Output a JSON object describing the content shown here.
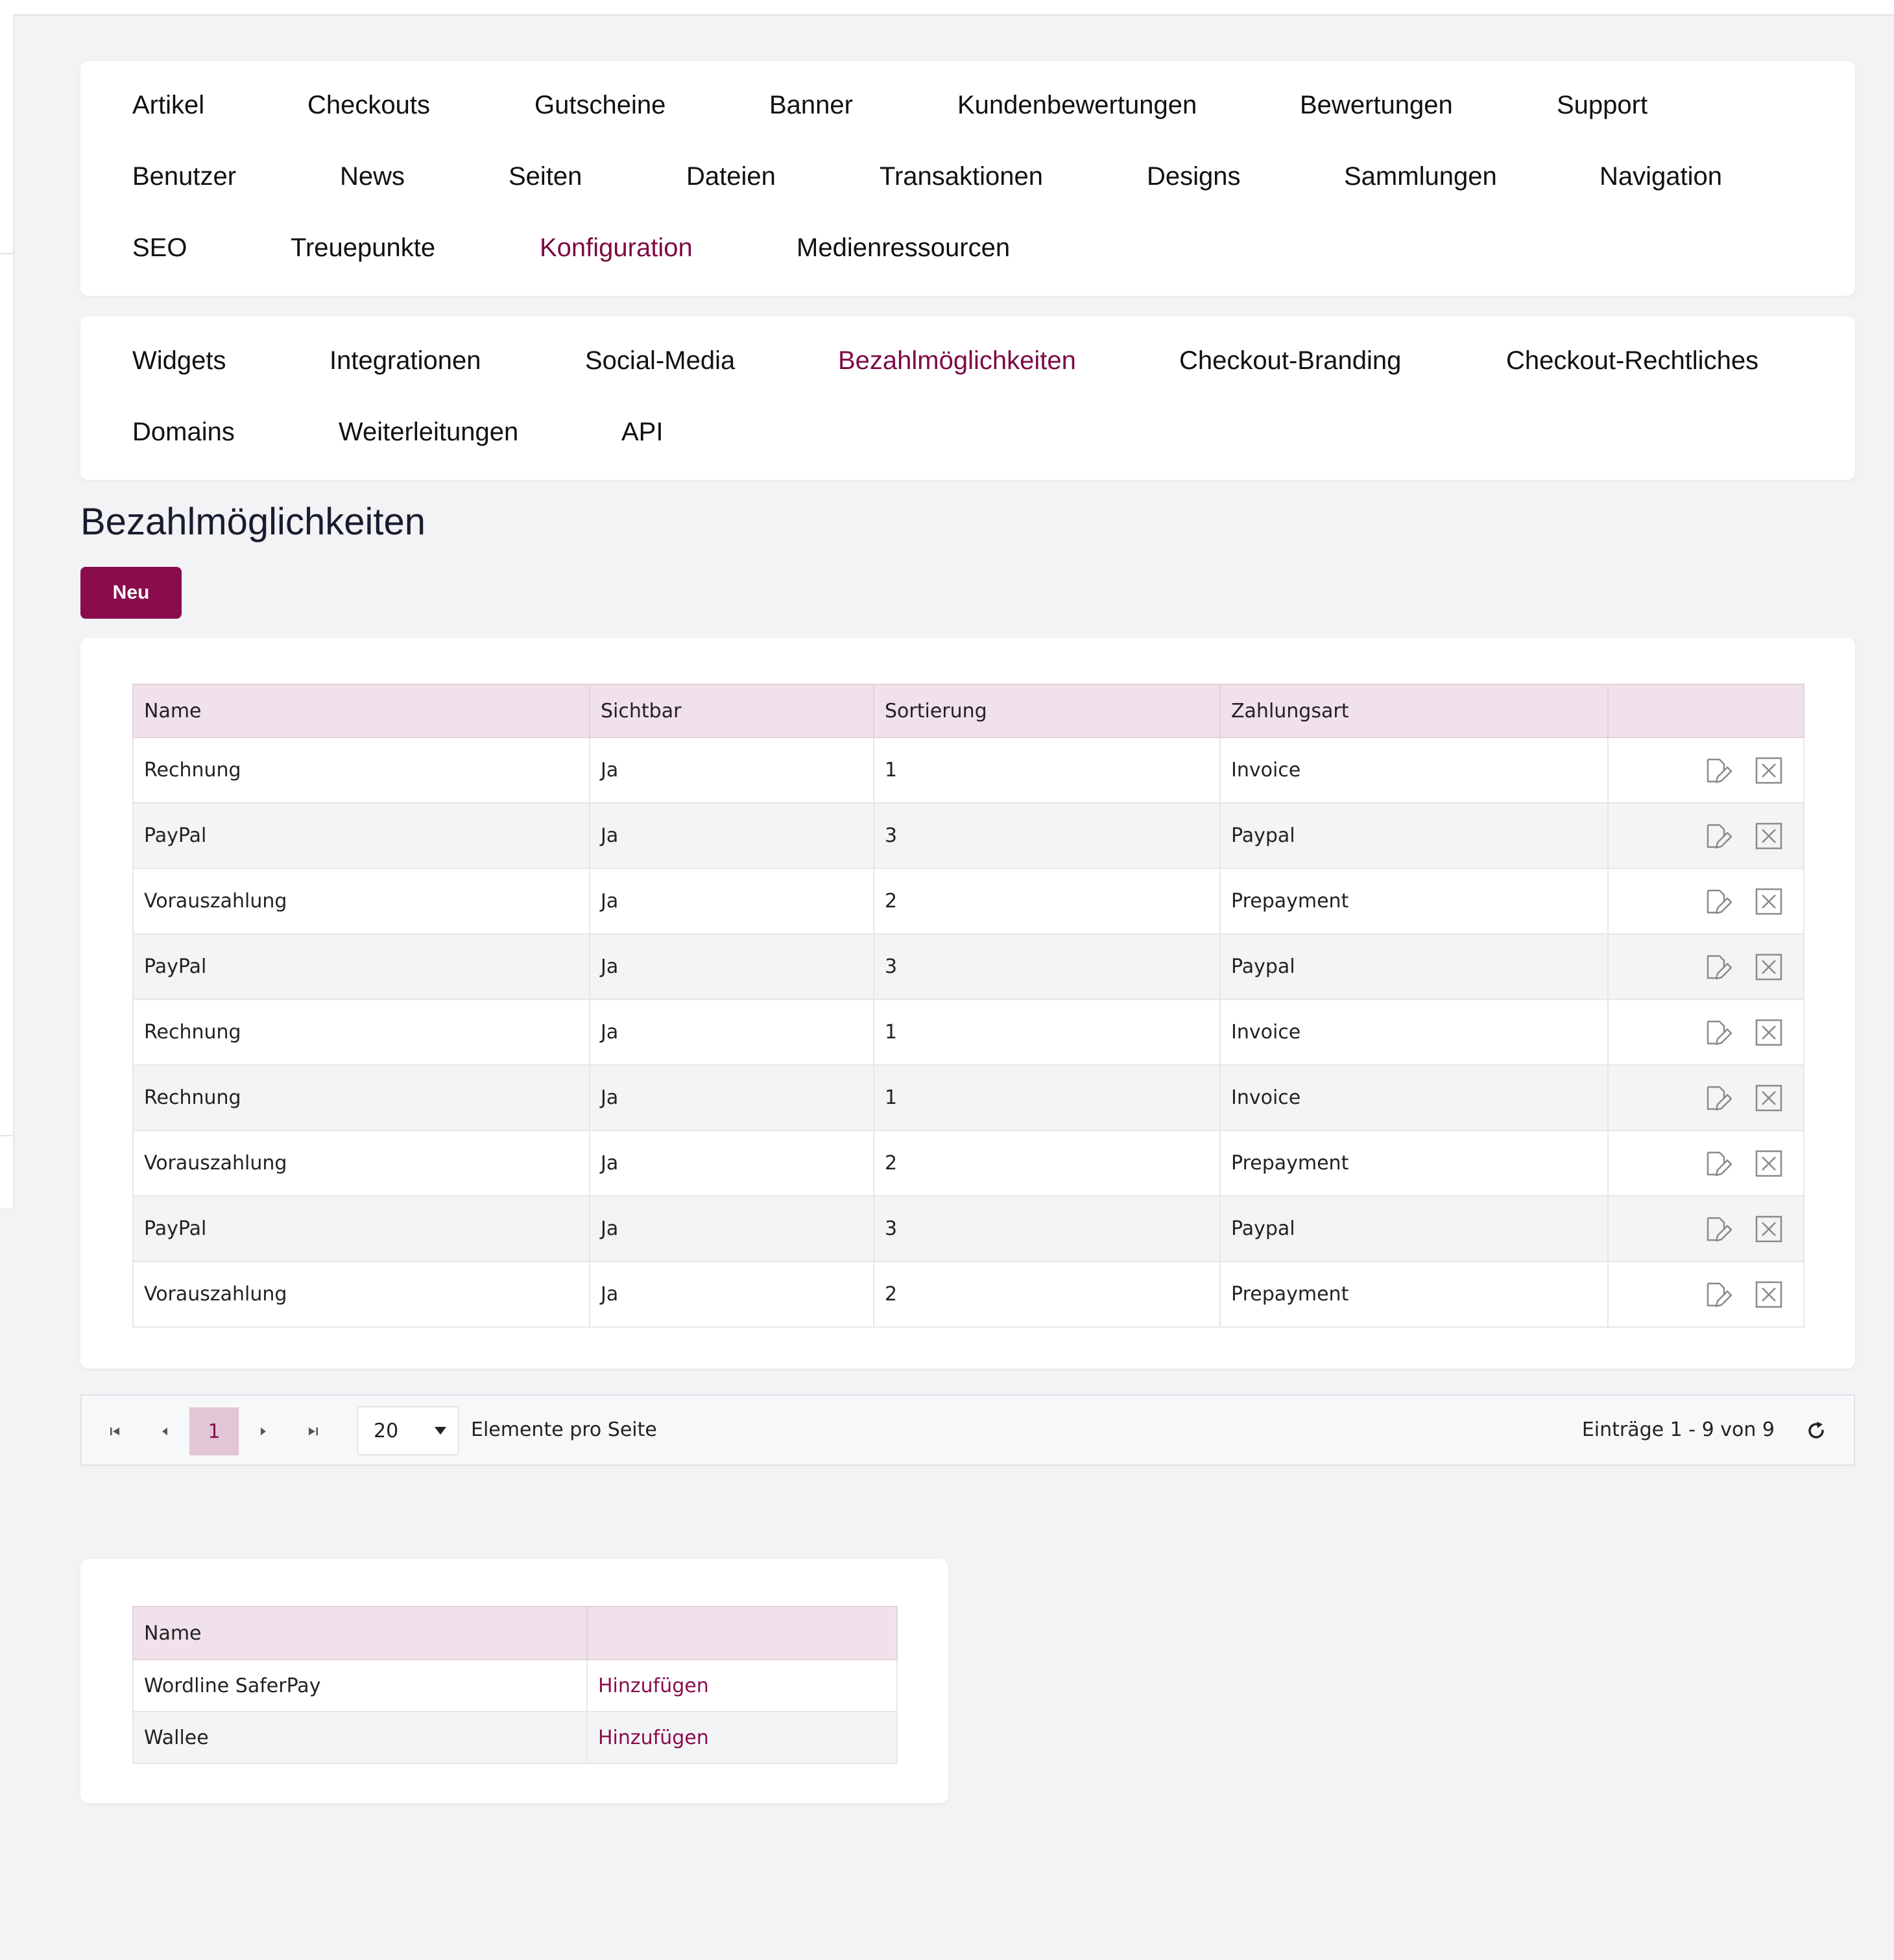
{
  "main_nav": {
    "items": [
      {
        "label": "Artikel",
        "active": false
      },
      {
        "label": "Checkouts",
        "active": false
      },
      {
        "label": "Gutscheine",
        "active": false
      },
      {
        "label": "Banner",
        "active": false
      },
      {
        "label": "Kundenbewertungen",
        "active": false
      },
      {
        "label": "Bewertungen",
        "active": false
      },
      {
        "label": "Support",
        "active": false
      },
      {
        "label": "Benutzer",
        "active": false
      },
      {
        "label": "News",
        "active": false
      },
      {
        "label": "Seiten",
        "active": false
      },
      {
        "label": "Dateien",
        "active": false
      },
      {
        "label": "Transaktionen",
        "active": false
      },
      {
        "label": "Designs",
        "active": false
      },
      {
        "label": "Sammlungen",
        "active": false
      },
      {
        "label": "Navigation",
        "active": false
      },
      {
        "label": "SEO",
        "active": false
      },
      {
        "label": "Treuepunkte",
        "active": false
      },
      {
        "label": "Konfiguration",
        "active": true
      },
      {
        "label": "Medienressourcen",
        "active": false
      }
    ]
  },
  "sub_nav": {
    "items": [
      {
        "label": "Widgets",
        "active": false
      },
      {
        "label": "Integrationen",
        "active": false
      },
      {
        "label": "Social-Media",
        "active": false
      },
      {
        "label": "Bezahlmöglichkeiten",
        "active": true
      },
      {
        "label": "Checkout-Branding",
        "active": false
      },
      {
        "label": "Checkout-Rechtliches",
        "active": false
      },
      {
        "label": "Domains",
        "active": false
      },
      {
        "label": "Weiterleitungen",
        "active": false
      },
      {
        "label": "API",
        "active": false
      }
    ]
  },
  "page": {
    "title": "Bezahlmöglichkeiten",
    "new_button": "Neu"
  },
  "table": {
    "columns": [
      "Name",
      "Sichtbar",
      "Sortierung",
      "Zahlungsart",
      ""
    ],
    "rows": [
      [
        "Rechnung",
        "Ja",
        "1",
        "Invoice"
      ],
      [
        "PayPal",
        "Ja",
        "3",
        "Paypal"
      ],
      [
        "Vorauszahlung",
        "Ja",
        "2",
        "Prepayment"
      ],
      [
        "PayPal",
        "Ja",
        "3",
        "Paypal"
      ],
      [
        "Rechnung",
        "Ja",
        "1",
        "Invoice"
      ],
      [
        "Rechnung",
        "Ja",
        "1",
        "Invoice"
      ],
      [
        "Vorauszahlung",
        "Ja",
        "2",
        "Prepayment"
      ],
      [
        "PayPal",
        "Ja",
        "3",
        "Paypal"
      ],
      [
        "Vorauszahlung",
        "Ja",
        "2",
        "Prepayment"
      ]
    ],
    "row_actions": [
      "edit-icon",
      "delete-icon"
    ]
  },
  "pagination": {
    "current_page": "1",
    "page_size": "20",
    "page_size_label": "Elemente pro Seite",
    "info": "Einträge 1 - 9 von 9",
    "icons": [
      "first-page-icon",
      "prev-page-icon",
      "next-page-icon",
      "last-page-icon",
      "refresh-icon"
    ]
  },
  "providers": {
    "columns": [
      "Name",
      ""
    ],
    "rows": [
      {
        "name": "Wordline SaferPay",
        "action": "Hinzufügen"
      },
      {
        "name": "Wallee",
        "action": "Hinzufügen"
      }
    ]
  },
  "colors": {
    "accent": "#8b0c4d",
    "active_nav": "#7d0a45",
    "table_header": "#f0e1ea",
    "page_background": "#f2f3f5"
  }
}
